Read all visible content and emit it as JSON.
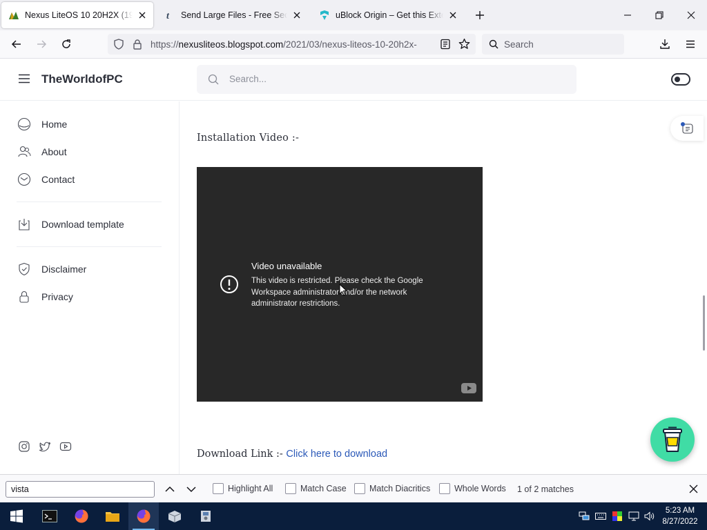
{
  "browser": {
    "tabs": [
      {
        "title": "Nexus LiteOS 10 20H2X (19042.8",
        "active": true,
        "favicon": "nexus-favicon"
      },
      {
        "title": "Send Large Files - Free Secure F",
        "active": false,
        "favicon": "tumblr-t-favicon"
      },
      {
        "title": "uBlock Origin – Get this Extensio",
        "active": false,
        "favicon": "ublock-favicon"
      }
    ],
    "url_prefix": "https://",
    "url_domain": "nexusliteos.blogspot.com",
    "url_path": "/2021/03/nexus-liteos-10-20h2x-",
    "search_placeholder": "Search"
  },
  "site": {
    "brand": "TheWorldofPC",
    "search_placeholder": "Search...",
    "nav": [
      {
        "label": "Home",
        "icon": "home-icon"
      },
      {
        "label": "About",
        "icon": "users-icon"
      },
      {
        "label": "Contact",
        "icon": "mail-icon"
      },
      {
        "label": "Download template",
        "icon": "download-icon"
      },
      {
        "label": "Disclaimer",
        "icon": "shield-check-icon"
      },
      {
        "label": "Privacy",
        "icon": "lock-icon"
      }
    ],
    "social_icons": [
      "instagram-icon",
      "twitter-icon",
      "youtube-icon"
    ]
  },
  "content": {
    "heading": "Installation Video :-",
    "video": {
      "title": "Video unavailable",
      "message": "This video is restricted. Please check the Google Workspace administrator and/or the network administrator restrictions."
    },
    "download_prefix": "Download Link :- ",
    "download_link": "Click here to download"
  },
  "findbar": {
    "query": "vista",
    "options": [
      "Highlight All",
      "Match Case",
      "Match Diacritics",
      "Whole Words"
    ],
    "match_count": "1 of 2 matches"
  },
  "taskbar": {
    "time": "5:23 AM",
    "date": "8/27/2022"
  },
  "colors": {
    "link": "#2b59b8",
    "coffee_button": "#40dca5",
    "taskbar": "#0a1e3c",
    "video_bg": "#282828"
  }
}
